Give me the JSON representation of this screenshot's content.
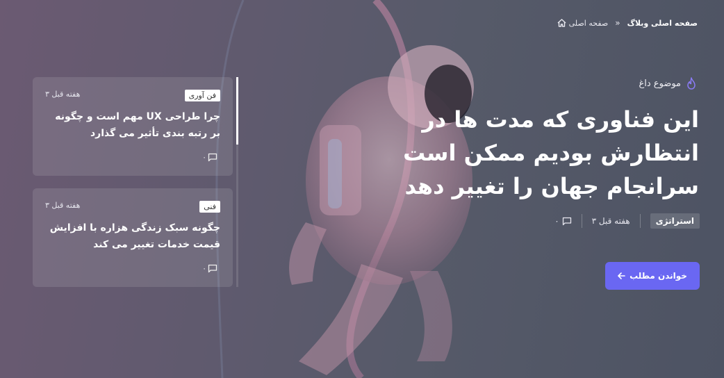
{
  "breadcrumb": {
    "home_label": "صفحه اصلی",
    "current_label": "صفحه اصلی وبلاگ"
  },
  "hero": {
    "hot_topic_label": "موضوع داغ",
    "title": "این فناوری که مدت ها در انتظارش بودیم ممکن است سرانجام جهان را تغییر دهد",
    "tag": "استراتژی",
    "time": "۳ هفته قبل",
    "comments": "۰",
    "read_button_label": "خواندن مطلب"
  },
  "side_cards": [
    {
      "badge": "فن آوری",
      "time": "۳ هفته قبل",
      "title": "چرا طراحی UX مهم است و چگونه بر رتبه بندی تأثیر می گذارد",
      "comments": "۰"
    },
    {
      "badge": "فنی",
      "time": "۳ هفته قبل",
      "title": "چگونه سبک زندگی هزاره با افزایش قیمت خدمات تغییر می کند",
      "comments": "۰"
    }
  ],
  "colors": {
    "accent": "#6a67f2",
    "flame": "#8b7cf7"
  },
  "icons": {
    "home": "home-icon",
    "separator": "double-chevron-icon",
    "flame": "flame-icon",
    "comment": "comment-icon",
    "arrow": "arrow-left-icon"
  }
}
